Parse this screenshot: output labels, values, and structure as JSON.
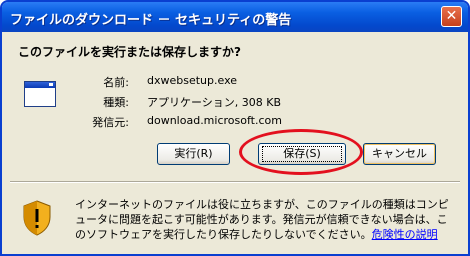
{
  "window": {
    "title": "ファイルのダウンロード － セキュリティの警告",
    "close_glyph": "✕"
  },
  "question": "このファイルを実行または保存しますか?",
  "file_icon": "application-window-icon",
  "fields": [
    {
      "label": "名前:",
      "value": "dxwebsetup.exe"
    },
    {
      "label": "種類:",
      "value": "アプリケーション, 308 KB"
    },
    {
      "label": "発信元:",
      "value": "download.microsoft.com"
    }
  ],
  "buttons": {
    "run": "実行(R)",
    "save": "保存(S)",
    "cancel": "キャンセル"
  },
  "warning": {
    "icon": "shield-warning-icon",
    "text": "インターネットのファイルは役に立ちますが、このファイルの種類はコンピュータに問題を起こす可能性があります。発信元が信頼できない場合は、このソフトウェアを実行したり保存したりしないでください。",
    "link": "危険性の説明"
  },
  "colors": {
    "titlebar": "#0a5fe2",
    "dialog_bg": "#ece9d8",
    "highlight": "#e3101e",
    "link": "#0000ff"
  }
}
